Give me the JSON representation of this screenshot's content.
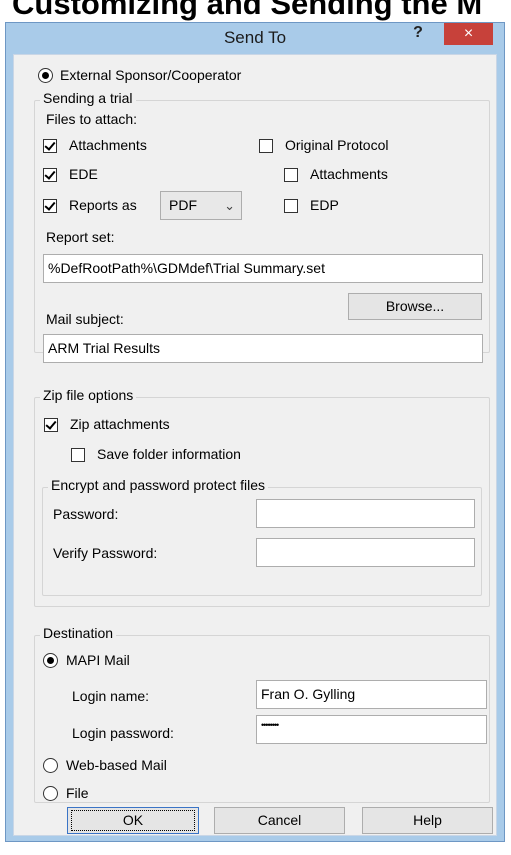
{
  "background_heading": "Customizing and Sending the M",
  "dialog": {
    "title": "Send To",
    "help_label": "?",
    "close_label": "×"
  },
  "recipient": {
    "label": "External Sponsor/Cooperator",
    "selected": true
  },
  "sending_trial": {
    "group_label": "Sending a trial",
    "files_to_attach_label": "Files to attach:",
    "attachments_label": "Attachments",
    "attachments_checked": true,
    "ede_label": "EDE",
    "ede_checked": true,
    "reports_as_label": "Reports as",
    "reports_as_checked": true,
    "reports_format": "PDF",
    "original_protocol_label": "Original Protocol",
    "original_protocol_checked": false,
    "sub_attachments_label": "Attachments",
    "sub_attachments_checked": false,
    "edp_label": "EDP",
    "edp_checked": false,
    "report_set_label": "Report set:",
    "report_set_value": "%DefRootPath%\\GDMdef\\Trial Summary.set",
    "browse_label": "Browse...",
    "mail_subject_label": "Mail subject:",
    "mail_subject_value": "ARM Trial Results"
  },
  "zip_options": {
    "group_label": "Zip file options",
    "zip_attachments_label": "Zip attachments",
    "zip_attachments_checked": true,
    "save_folder_label": "Save folder information",
    "save_folder_checked": false,
    "encrypt_group_label": "Encrypt and password protect files",
    "password_label": "Password:",
    "password_value": "",
    "verify_password_label": "Verify Password:",
    "verify_password_value": ""
  },
  "destination": {
    "group_label": "Destination",
    "mapi_label": "MAPI Mail",
    "mapi_selected": true,
    "login_name_label": "Login name:",
    "login_name_value": "Fran O. Gylling",
    "login_password_label": "Login password:",
    "login_password_value": "••••••••",
    "web_mail_label": "Web-based Mail",
    "web_mail_selected": false,
    "file_label": "File",
    "file_selected": false
  },
  "buttons": {
    "ok": "OK",
    "cancel": "Cancel",
    "help": "Help"
  }
}
